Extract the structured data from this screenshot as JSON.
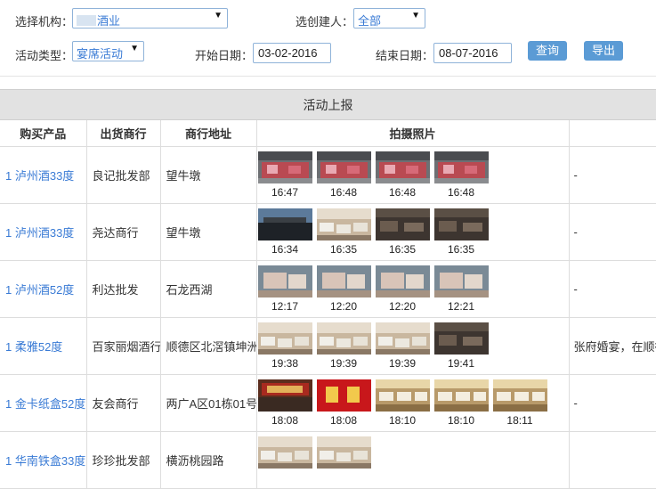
{
  "filters": {
    "org_label": "选择机构：",
    "org_value": "酒业",
    "creator_label": "选创建人：",
    "creator_value": "全部",
    "type_label": "活动类型：",
    "type_value": "宴席活动",
    "start_label": "开始日期：",
    "start_value": "03-02-2016",
    "end_label": "结束日期：",
    "end_value": "08-07-2016",
    "query_btn": "查询",
    "export_btn": "导出"
  },
  "panel": {
    "title": "活动上报",
    "columns": [
      "购买产品",
      "出货商行",
      "商行地址",
      "拍摄照片",
      ""
    ]
  },
  "rows": [
    {
      "product": "1 泸州酒33度",
      "dealer": "良记批发部",
      "address": "望牛墩",
      "photos": [
        {
          "time": "16:47",
          "scene": "banquet"
        },
        {
          "time": "16:48",
          "scene": "banquet"
        },
        {
          "time": "16:48",
          "scene": "banquet"
        },
        {
          "time": "16:48",
          "scene": "banquet"
        }
      ],
      "note": "-"
    },
    {
      "product": "1 泸州酒33度",
      "dealer": "尧达商行",
      "address": "望牛墩",
      "photos": [
        {
          "time": "16:34",
          "scene": "outdoor"
        },
        {
          "time": "16:35",
          "scene": "hall"
        },
        {
          "time": "16:35",
          "scene": "dark"
        },
        {
          "time": "16:35",
          "scene": "dark"
        }
      ],
      "note": "-"
    },
    {
      "product": "1 泸州酒52度",
      "dealer": "利达批发",
      "address": "石龙西湖",
      "photos": [
        {
          "time": "12:17",
          "scene": "table"
        },
        {
          "time": "12:20",
          "scene": "table"
        },
        {
          "time": "12:20",
          "scene": "table"
        },
        {
          "time": "12:21",
          "scene": "table"
        }
      ],
      "note": "-"
    },
    {
      "product": "1 柔雅52度",
      "dealer": "百家丽烟酒行",
      "address": "顺德区北滘镇坤洲",
      "photos": [
        {
          "time": "19:38",
          "scene": "hall"
        },
        {
          "time": "19:39",
          "scene": "hall"
        },
        {
          "time": "19:39",
          "scene": "hall"
        },
        {
          "time": "19:41",
          "scene": "dark"
        }
      ],
      "note": "张府婚宴，在顺德"
    },
    {
      "product": "1 金卡纸盒52度",
      "dealer": "友会商行",
      "address": "两广A区01栋01号",
      "photos": [
        {
          "time": "18:08",
          "scene": "sign"
        },
        {
          "time": "18:08",
          "scene": "red"
        },
        {
          "time": "18:10",
          "scene": "restaurant"
        },
        {
          "time": "18:10",
          "scene": "restaurant"
        },
        {
          "time": "18:11",
          "scene": "restaurant"
        }
      ],
      "note": "-"
    },
    {
      "product": "1 华南铁盒33度",
      "dealer": "珍珍批发部",
      "address": "横沥桃园路",
      "photos": [
        {
          "time": "",
          "scene": "hall"
        },
        {
          "time": "",
          "scene": "hall"
        }
      ],
      "note": ""
    }
  ]
}
